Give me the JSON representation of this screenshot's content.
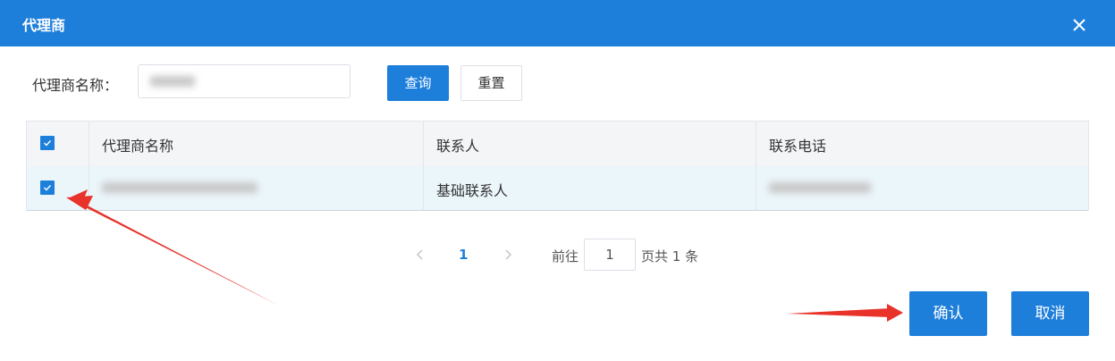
{
  "dialog": {
    "title": "代理商",
    "close_icon": "close-icon"
  },
  "search": {
    "label": "代理商名称：",
    "value_blurred": true,
    "query_label": "查询",
    "reset_label": "重置"
  },
  "table": {
    "header_checked": true,
    "columns": [
      "代理商名称",
      "联系人",
      "联系电话"
    ],
    "rows": [
      {
        "checked": true,
        "name_blurred": true,
        "contact": "基础联系人",
        "phone_blurred": true
      }
    ]
  },
  "pagination": {
    "current_page": "1",
    "goto_label": "前往",
    "goto_value": "1",
    "total_label": "页共 1 条"
  },
  "footer": {
    "confirm_label": "确认",
    "cancel_label": "取消"
  },
  "colors": {
    "primary": "#1e7fdb",
    "annotation_arrow": "#e8322a"
  }
}
